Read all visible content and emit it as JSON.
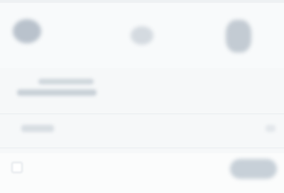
{
  "title": "",
  "top_tiles": [
    {
      "icon": "blurred-icon",
      "label": ""
    },
    {
      "icon": "blurred-icon",
      "label": ""
    },
    {
      "icon": "blurred-icon",
      "label": ""
    }
  ],
  "info_card": {
    "line1": "",
    "line2": ""
  },
  "list_row": {
    "label": "",
    "chevron": "chevron-right-icon"
  },
  "actions": {
    "checkbox_label": "",
    "primary_label": ""
  },
  "colors": {
    "background": "#f6f8f9",
    "tile_dark": "#b9c2cc",
    "tile_light": "#d4dae0",
    "button": "#c7d0d8"
  }
}
